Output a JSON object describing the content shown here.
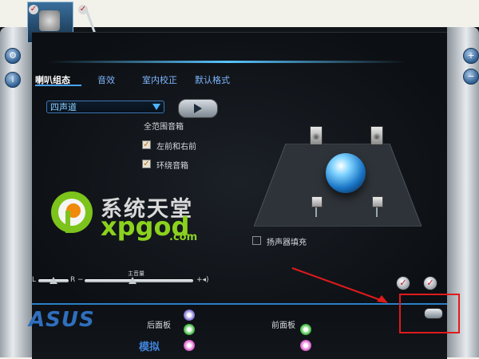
{
  "tabs": [
    "喇叭组态",
    "音效",
    "室内校正",
    "默认格式"
  ],
  "channel_select": {
    "value": "四声道"
  },
  "fullrange_title": "全范围音箱",
  "options": [
    {
      "label": "左前和右前",
      "checked": true
    },
    {
      "label": "环绕音箱",
      "checked": true
    }
  ],
  "speaker_fill": {
    "label": "扬声器填充",
    "checked": false
  },
  "volume": {
    "left_label": "L",
    "right_label": "R",
    "master_label": "主音量"
  },
  "watermark": {
    "cn": "系统天堂",
    "brand": "xpgod",
    "suffix": ".com"
  },
  "brand_logo": "ASUS",
  "bottom": {
    "rear_label": "后面板",
    "front_label": "前面板",
    "analog_label": "模拟"
  },
  "colors": {
    "accent": "#49a5ff",
    "annotation": "#e01a1a"
  }
}
